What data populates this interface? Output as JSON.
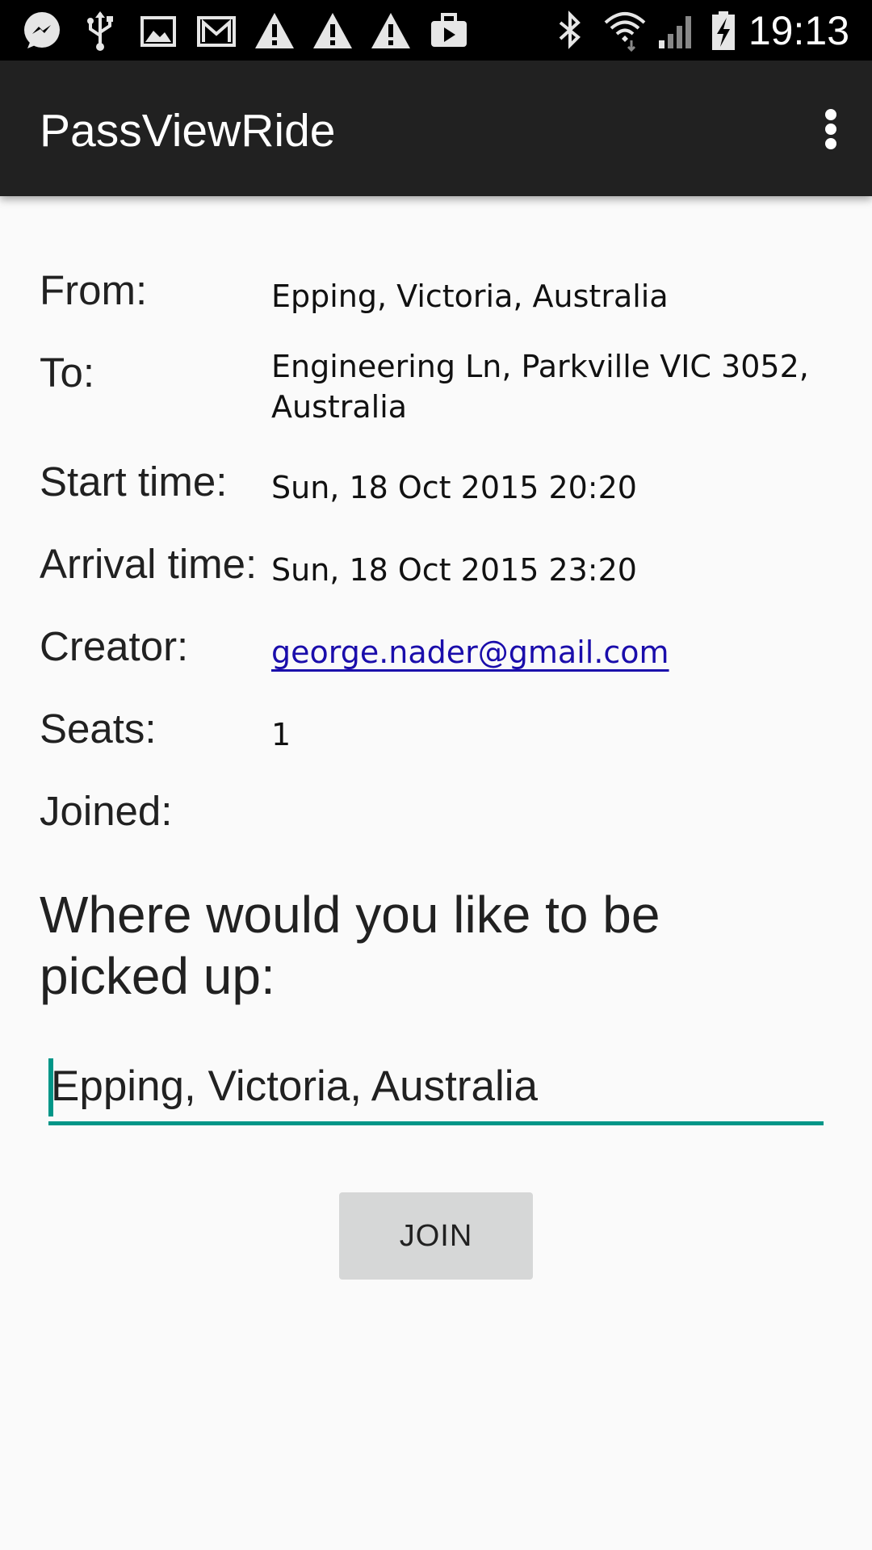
{
  "status_bar": {
    "time": "19:13",
    "icons": [
      "messenger-icon",
      "usb-icon",
      "image-icon",
      "gmail-icon",
      "warning-icon",
      "warning-icon",
      "warning-icon",
      "briefcase-icon",
      "bluetooth-icon",
      "wifi-icon",
      "signal-icon",
      "battery-charging-icon"
    ]
  },
  "app_bar": {
    "title": "PassViewRide",
    "overflow_icon": "more-vert-icon"
  },
  "details": {
    "from_label": "From:",
    "from_value": "Epping, Victoria, Australia",
    "to_label": "To:",
    "to_value": "Engineering Ln, Parkville VIC 3052, Australia",
    "start_label": "Start time:",
    "start_value": "Sun, 18 Oct 2015 20:20",
    "arrival_label": "Arrival time:",
    "arrival_value": "Sun, 18 Oct 2015 23:20",
    "creator_label": "Creator:",
    "creator_value": "george.nader@gmail.com",
    "seats_label": "Seats:",
    "seats_value": "1",
    "joined_label": "Joined:"
  },
  "pickup": {
    "question": "Where would you like to be picked up:",
    "input_value": "Epping, Victoria, Australia"
  },
  "join_button": {
    "label": "JOIN"
  },
  "colors": {
    "accent": "#009688",
    "app_bar": "#212121",
    "background": "#fafafa",
    "button": "#d6d7d7",
    "link": "#1a0dab"
  }
}
